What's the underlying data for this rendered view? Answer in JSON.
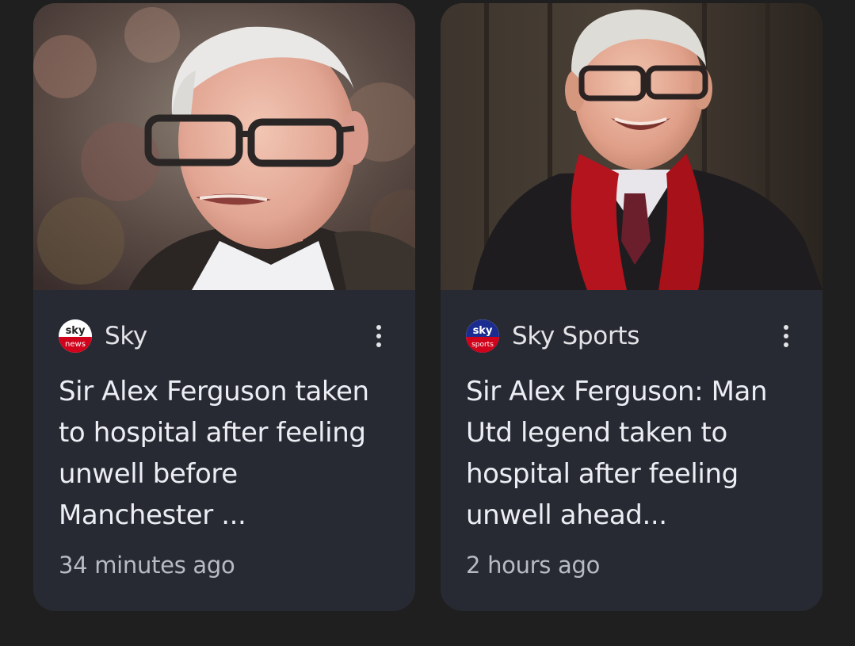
{
  "articles": [
    {
      "source": {
        "name": "Sky",
        "logo_top": "sky",
        "logo_bottom": "news",
        "logo_color": "#d0021b"
      },
      "headline": "Sir Alex Ferguson taken to hospital after feeling unwell before Manchester ...",
      "timestamp": "34 minutes ago"
    },
    {
      "source": {
        "name": "Sky Sports",
        "logo_top": "sky",
        "logo_bottom": "sports",
        "logo_color": "#1a2c8f"
      },
      "headline": "Sir Alex Ferguson: Man Utd legend taken to hospital after feeling unwell ahead...",
      "timestamp": "2 hours ago"
    }
  ],
  "colors": {
    "page_bg": "#1f1f1f",
    "card_bg": "#282a33",
    "headline_text": "#eceef4",
    "meta_text": "#b8bac4"
  }
}
